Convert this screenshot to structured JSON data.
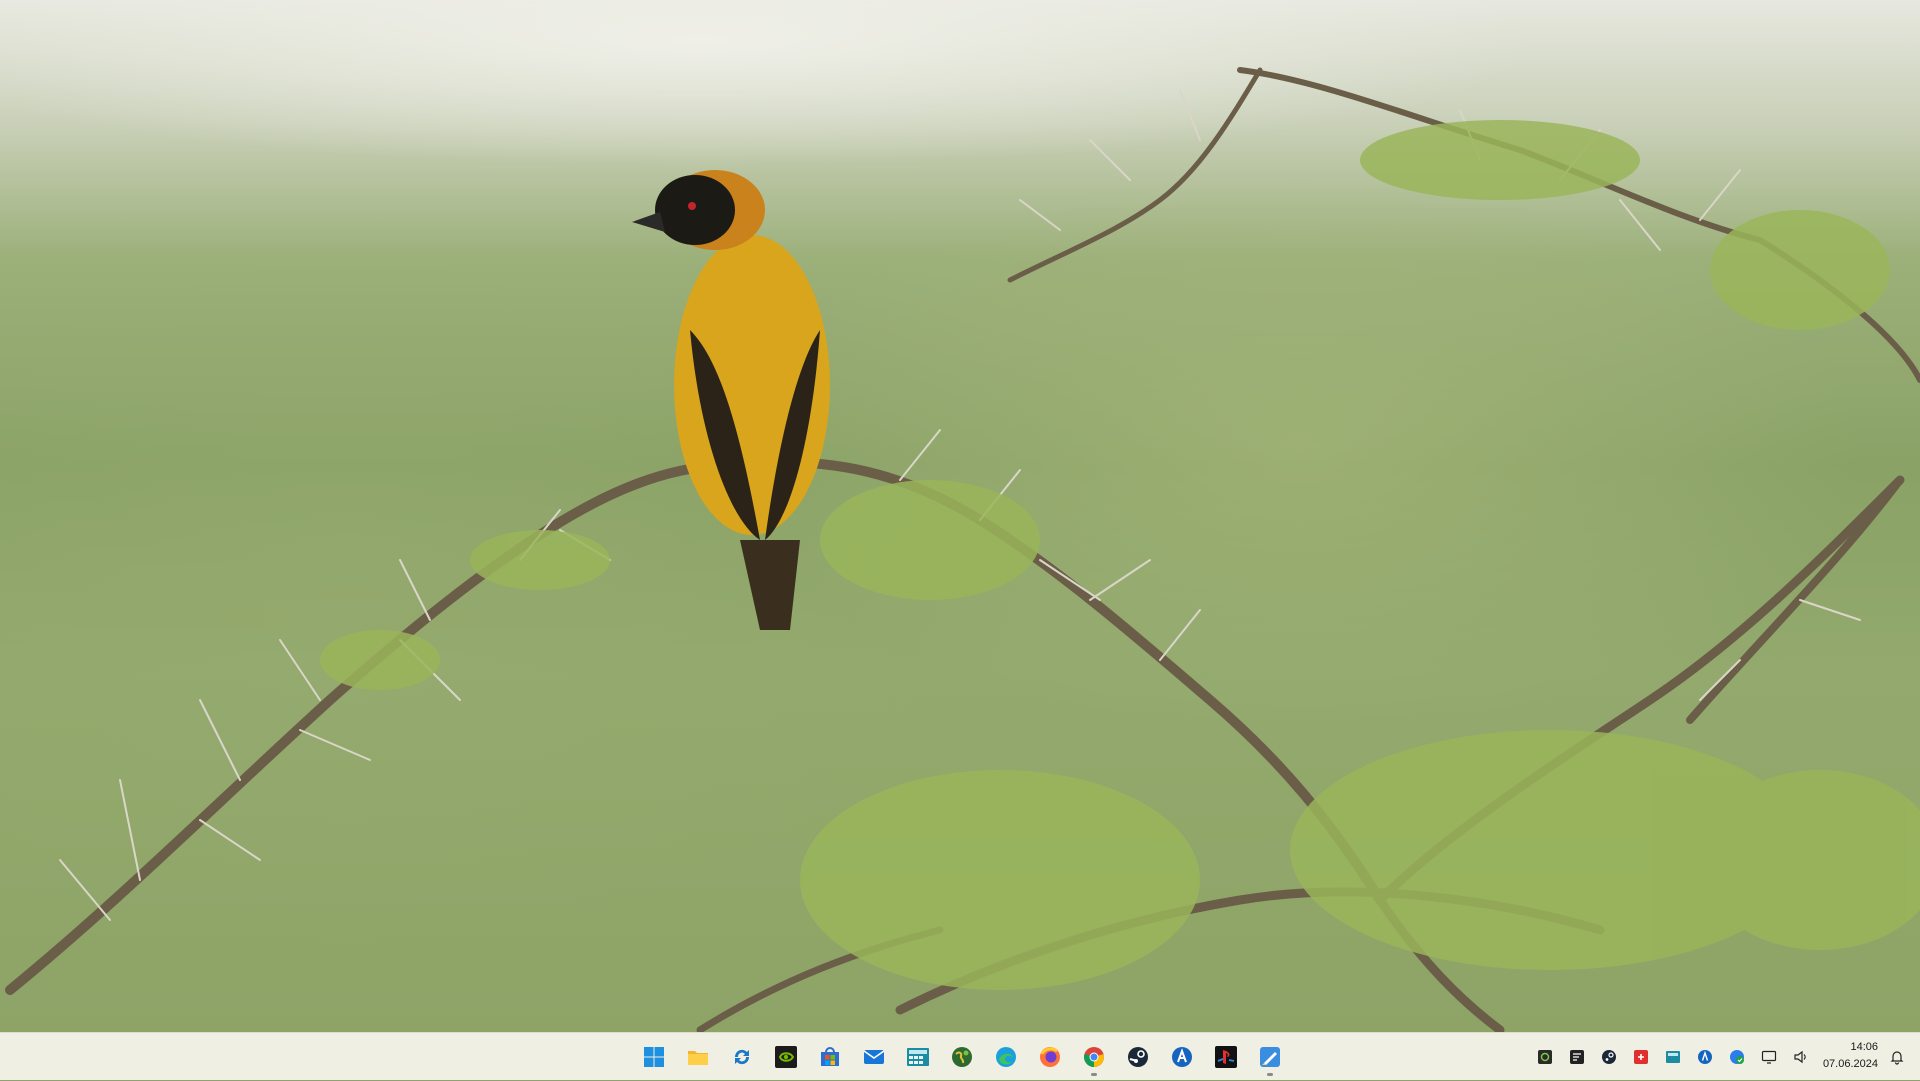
{
  "desktop": {
    "wallpaper_subject": "bird-on-thorny-branch"
  },
  "taskbar": {
    "pinned": [
      {
        "name": "start-button",
        "icon": "windows-icon",
        "running": false
      },
      {
        "name": "file-explorer-button",
        "icon": "folder-icon",
        "running": false
      },
      {
        "name": "sync-app-button",
        "icon": "sync-icon",
        "running": false
      },
      {
        "name": "nvidia-button",
        "icon": "nvidia-icon",
        "running": false
      },
      {
        "name": "store-button",
        "icon": "store-icon",
        "running": false
      },
      {
        "name": "mail-button",
        "icon": "mail-icon",
        "running": false
      },
      {
        "name": "calculator-button",
        "icon": "calculator-icon",
        "running": false
      },
      {
        "name": "globe-app-button",
        "icon": "globe-icon",
        "running": false
      },
      {
        "name": "edge-button",
        "icon": "edge-icon",
        "running": false
      },
      {
        "name": "firefox-button",
        "icon": "firefox-icon",
        "running": false
      },
      {
        "name": "chrome-button",
        "icon": "chrome-icon",
        "running": true
      },
      {
        "name": "steam-button",
        "icon": "steam-icon",
        "running": false
      },
      {
        "name": "app-launcher-button",
        "icon": "launcher-icon",
        "running": false
      },
      {
        "name": "playstation-button",
        "icon": "playstation-icon",
        "running": false
      },
      {
        "name": "paint-app-button",
        "icon": "paint-icon",
        "running": true
      }
    ],
    "tray": [
      {
        "name": "tray-network-app-icon",
        "icon": "network-app-icon"
      },
      {
        "name": "tray-pc-app-icon",
        "icon": "pc-app-icon"
      },
      {
        "name": "tray-steam-icon",
        "icon": "steam-icon"
      },
      {
        "name": "tray-red-app-icon",
        "icon": "red-app-icon"
      },
      {
        "name": "tray-calculator-icon",
        "icon": "calculator-icon"
      },
      {
        "name": "tray-launcher-icon",
        "icon": "launcher-icon"
      },
      {
        "name": "tray-security-icon",
        "icon": "security-icon"
      },
      {
        "name": "tray-display-icon",
        "icon": "display-icon"
      },
      {
        "name": "tray-volume-icon",
        "icon": "volume-icon"
      }
    ],
    "clock": {
      "time": "14:06",
      "date": "07.06.2024"
    },
    "colors": {
      "bar": "#efefe3",
      "running_indicator": "#8a8a8a"
    }
  }
}
